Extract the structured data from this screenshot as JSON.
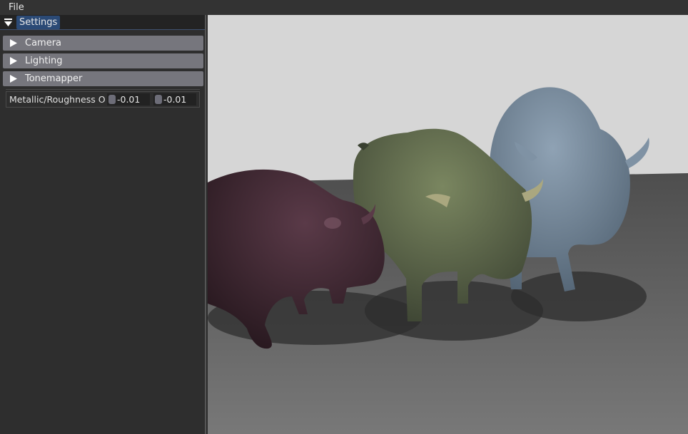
{
  "menubar": {
    "file_label": "File"
  },
  "panel": {
    "tab_label": "Settings",
    "sections": [
      {
        "label": "Camera"
      },
      {
        "label": "Lighting"
      },
      {
        "label": "Tonemapper"
      }
    ],
    "override": {
      "label": "Metallic/Roughness Ov",
      "metallic_value": "-0.01",
      "roughness_value": "-0.01"
    }
  },
  "icons": {
    "collapse": "triangle-down-icon",
    "section_expand": "triangle-right-icon"
  },
  "colors": {
    "accent_tab": "#2b4a76",
    "section_header": "#76767d",
    "bison_left": "#3a252e",
    "bison_middle": "#5a6647",
    "bison_right": "#6f8294"
  }
}
